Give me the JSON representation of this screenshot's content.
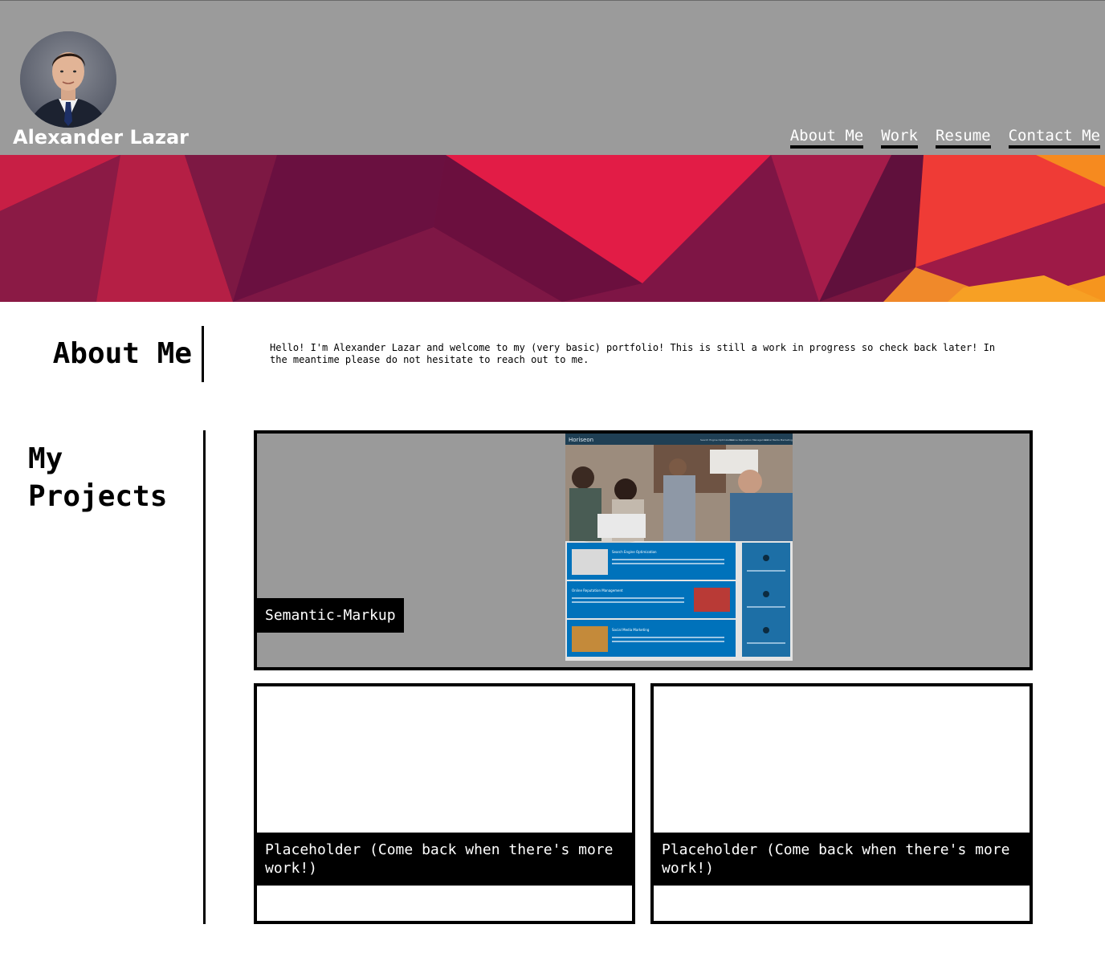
{
  "header": {
    "site_name": "Alexander Lazar",
    "nav": [
      {
        "label": "About Me"
      },
      {
        "label": "Work"
      },
      {
        "label": "Resume"
      },
      {
        "label": "Contact Me"
      }
    ]
  },
  "about": {
    "title": "About Me",
    "text": "Hello! I'm Alexander Lazar and welcome to my (very basic) portfolio! This is still a work in progress so check back later! In the meantime please do not hesitate to reach out to me."
  },
  "projects": {
    "title": "My Projects",
    "items": [
      {
        "label": "Semantic-Markup"
      },
      {
        "label": "Placeholder (Come back when there's more work!)"
      },
      {
        "label": "Placeholder (Come back when there's more work!)"
      }
    ],
    "screenshot": {
      "brand": "Horiseon",
      "nav": [
        "Search Engine Optimization",
        "Online Reputation Management",
        "Social Media Marketing"
      ],
      "sections": [
        "Search Engine Optimization",
        "Online Reputation Management",
        "Social Media Marketing"
      ]
    }
  },
  "colors": {
    "header_bg": "#9b9b9b",
    "card_bg": "#9a9a9a",
    "label_bg": "#000000",
    "horiseon_blue": "#0072bb"
  }
}
